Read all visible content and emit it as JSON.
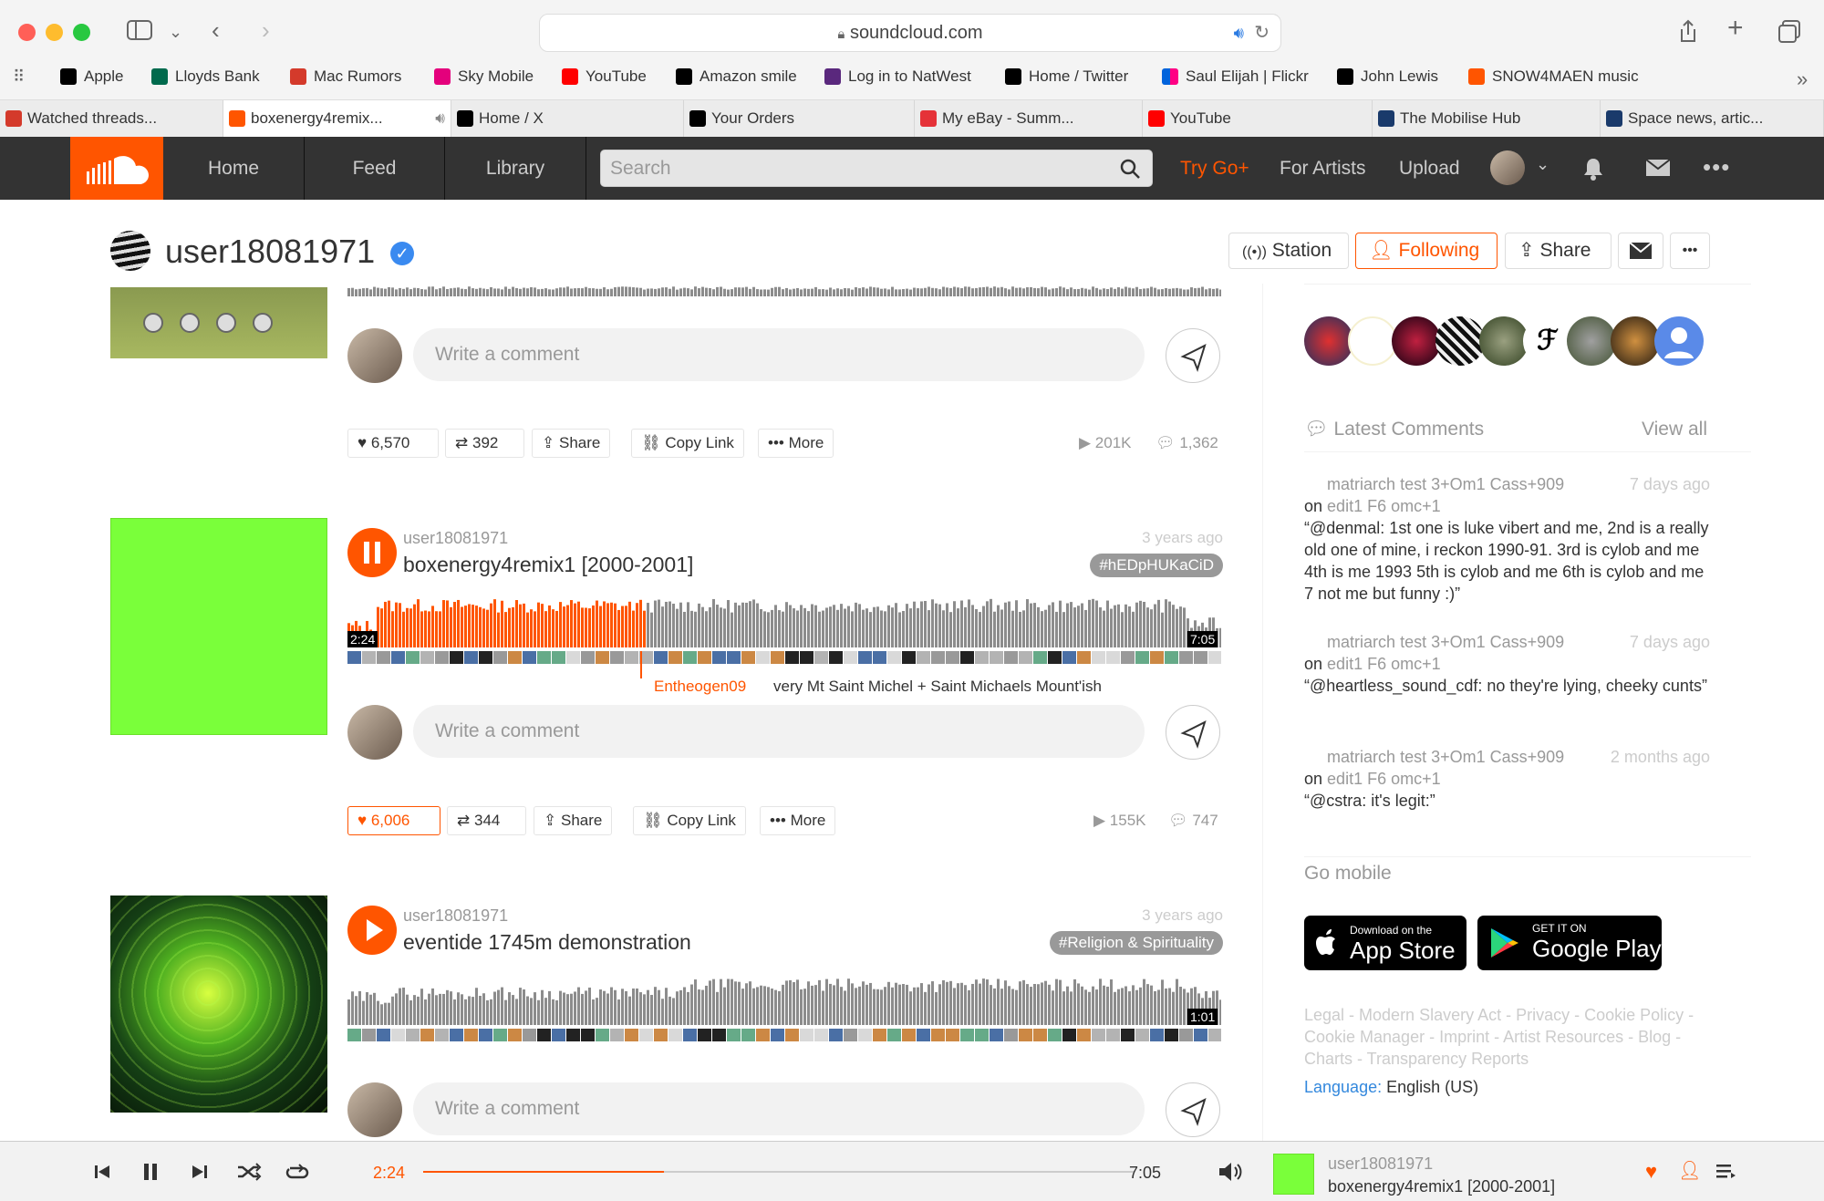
{
  "browser": {
    "url": "soundcloud.com",
    "bookmarks": [
      {
        "label": "Apple",
        "color": "#000000"
      },
      {
        "label": "Lloyds Bank",
        "color": "#006a4d"
      },
      {
        "label": "Mac Rumors",
        "color": "#d43a2b"
      },
      {
        "label": "Sky Mobile",
        "color": "#e4007c"
      },
      {
        "label": "YouTube",
        "color": "#ff0000"
      },
      {
        "label": "Amazon smile",
        "color": "#000000"
      },
      {
        "label": "Log in to NatWest",
        "color": "#5a287d"
      },
      {
        "label": "Home / Twitter",
        "color": "#000000"
      },
      {
        "label": "Saul Elijah | Flickr",
        "color": "#0063dc"
      },
      {
        "label": "John Lewis",
        "color": "#000000"
      },
      {
        "label": "SNOW4MAEN music",
        "color": "#ff5500"
      }
    ],
    "tabs": [
      {
        "label": "Watched threads...",
        "color": "#d43a2b"
      },
      {
        "label": "boxenergy4remix...",
        "color": "#ff5500"
      },
      {
        "label": "Home / X",
        "color": "#000000"
      },
      {
        "label": "Your Orders",
        "color": "#000000"
      },
      {
        "label": "My eBay - Summ...",
        "color": "#e53238"
      },
      {
        "label": "YouTube",
        "color": "#ff0000"
      },
      {
        "label": "The Mobilise Hub",
        "color": "#1a3a6b"
      },
      {
        "label": "Space news, artic...",
        "color": "#1a3a6b"
      }
    ]
  },
  "nav": {
    "home": "Home",
    "feed": "Feed",
    "library": "Library",
    "search_placeholder": "Search",
    "try_go": "Try Go+",
    "for_artists": "For Artists",
    "upload": "Upload"
  },
  "profile": {
    "username": "user18081971",
    "station": "Station",
    "following": "Following",
    "share": "Share"
  },
  "tracks": [
    {
      "comment_placeholder": "Write a comment",
      "likes": "6,570",
      "reposts": "392",
      "share": "Share",
      "copy_link": "Copy Link",
      "more": "More",
      "plays": "201K",
      "comments": "1,362"
    },
    {
      "user": "user18081971",
      "title": "boxenergy4remix1 [2000-2001]",
      "time": "3 years ago",
      "tag": "#hEDpHUKaCiD",
      "position": "2:24",
      "duration": "7:05",
      "progress": 0.339,
      "wave_comment_user": "Entheogen09",
      "wave_comment_text": "very Mt Saint Michel + Saint Michaels Mount'ish",
      "comment_placeholder": "Write a comment",
      "likes": "6,006",
      "reposts": "344",
      "share": "Share",
      "copy_link": "Copy Link",
      "more": "More",
      "plays": "155K",
      "comments": "747",
      "art_color": "#7aff3a"
    },
    {
      "user": "user18081971",
      "title": "eventide 1745m demonstration",
      "time": "3 years ago",
      "tag": "#Religion & Spirituality",
      "duration": "1:01",
      "comment_placeholder": "Write a comment"
    }
  ],
  "sidebar": {
    "latest_comments": "Latest Comments",
    "view_all": "View all",
    "comments": [
      {
        "on": "on",
        "track": "matriarch test 3+Om1 Cass+909 edit1 F6 omc+1",
        "when": "7 days ago",
        "text": "“@denmal: 1st one is luke vibert and me, 2nd is a really old one of mine, i reckon 1990-91. 3rd is cylob and me 4th is me 1993 5th is cylob and me 6th is cylob and me 7 not me but funny :)”"
      },
      {
        "on": "on",
        "track": "matriarch test 3+Om1 Cass+909 edit1 F6 omc+1",
        "when": "7 days ago",
        "text": "“@heartless_sound_cdf: no they're lying, cheeky cunts”"
      },
      {
        "on": "on",
        "track": "matriarch test 3+Om1 Cass+909 edit1 F6 omc+1",
        "when": "2 months ago",
        "text": "“@cstra: it's legit:”"
      }
    ],
    "go_mobile": "Go mobile",
    "app_store_small": "Download on the",
    "app_store": "App Store",
    "google_small": "GET IT ON",
    "google": "Google Play",
    "footer_links": "Legal - Modern Slavery Act - Privacy - Cookie Policy - Cookie Manager - Imprint - Artist Resources - Blog - Charts - Transparency Reports",
    "language_label": "Language:",
    "language_value": "English (US)"
  },
  "player": {
    "position": "2:24",
    "duration": "7:05",
    "progress": 0.339,
    "user": "user18081971",
    "title": "boxenergy4remix1 [2000-2001]",
    "accent": "#ff5500"
  }
}
